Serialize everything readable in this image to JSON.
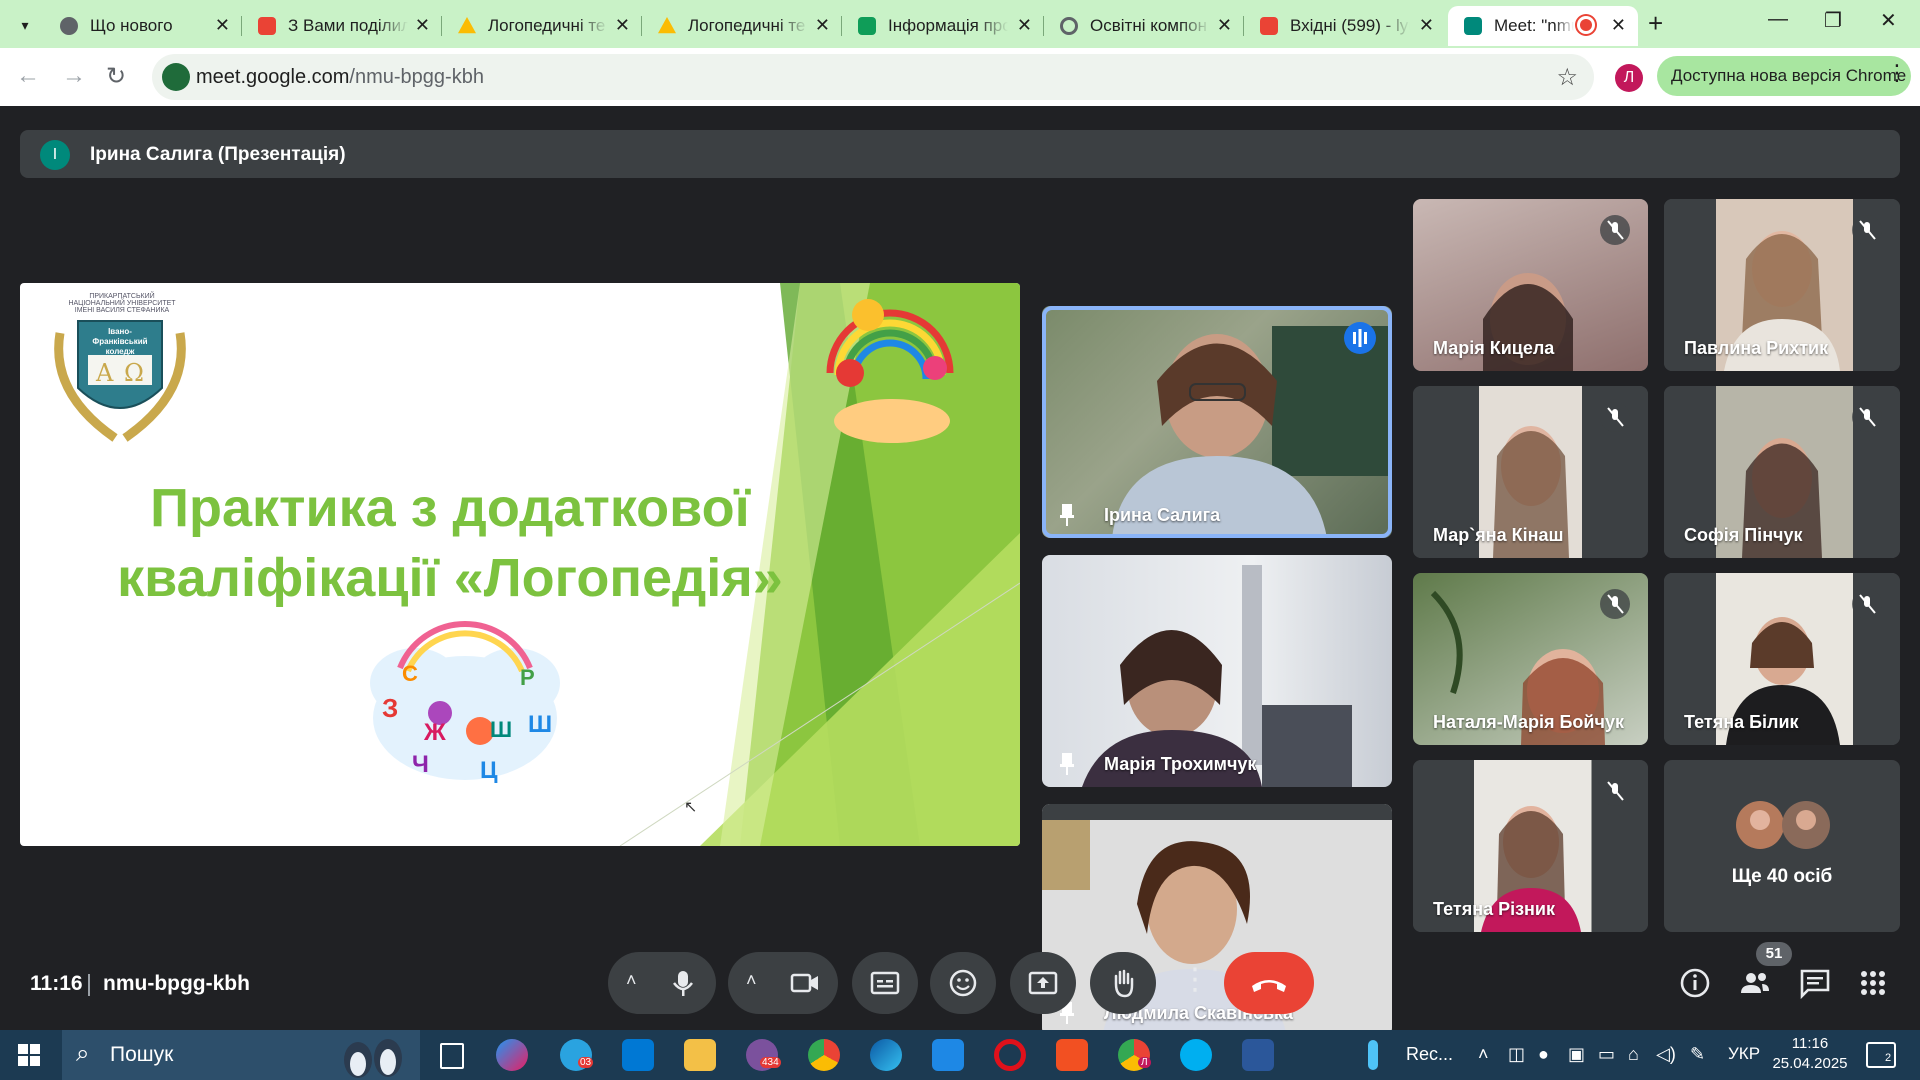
{
  "browser": {
    "tabs": [
      {
        "title": "Що нового",
        "icon": "chrome-icon",
        "color": "#5f6368"
      },
      {
        "title": "З Вами поділил",
        "icon": "gmail-icon",
        "color": "#ea4335"
      },
      {
        "title": "Логопедичні те",
        "icon": "drive-icon",
        "color": "#fbbc04"
      },
      {
        "title": "Логопедичні те",
        "icon": "drive-icon",
        "color": "#fbbc04"
      },
      {
        "title": "Інформація про",
        "icon": "sheets-icon",
        "color": "#0f9d58"
      },
      {
        "title": "Освітні компон",
        "icon": "globe-icon",
        "color": "#5f6368"
      },
      {
        "title": "Вхідні (599) - lyu",
        "icon": "gmail-icon",
        "color": "#ea4335"
      },
      {
        "title": "Meet: \"nmu-",
        "icon": "meet-icon",
        "color": "#00897b",
        "active": true
      }
    ],
    "url_host": "meet.google.com",
    "url_path": "/nmu-bpgg-kbh",
    "profile_initial": "Л",
    "update_label": "Доступна нова версія Chrome"
  },
  "meet": {
    "presenter_initial": "I",
    "presenter_label": "Ірина Салига (Презентація)",
    "slide": {
      "title_line1": "Практика з додаткової",
      "title_line2": "кваліфікації «Логопедія»",
      "college_caption": "ПРИКАРПАТСЬКИЙ НАЦІОНАЛЬНИЙ УНІВЕРСИТЕТ ІМЕНІ ВАСИЛЯ СТЕФАНИКА",
      "college_name": "Івано-Франківський коледж",
      "letters": [
        "З",
        "С",
        "Р",
        "Ш",
        "Ж",
        "Ч",
        "Ц",
        "Ш"
      ]
    },
    "main_tiles": [
      {
        "name": "Ірина Салига",
        "pinned": true,
        "speaking": true
      },
      {
        "name": "Марія Трохимчук",
        "pinned": true
      },
      {
        "name": "Людмила Скавінська",
        "pinned": true
      }
    ],
    "grid_tiles": [
      {
        "name": "Марія Кицела",
        "muted": true
      },
      {
        "name": "Павлина Рихтик",
        "muted": true
      },
      {
        "name": "Мар`яна Кінаш",
        "muted": true
      },
      {
        "name": "Софія Пінчук",
        "muted": true
      },
      {
        "name": "Наталя-Марія Бойчук",
        "muted": true
      },
      {
        "name": "Тетяна Білик",
        "muted": true
      },
      {
        "name": "Тетяна Різник",
        "muted": true
      }
    ],
    "more_label": "Ще 40 осіб",
    "time": "11:16",
    "meeting_code": "nmu-bpgg-kbh",
    "participants_count": "51"
  },
  "taskbar": {
    "search_label": "Пошук",
    "telegram_badge": "03",
    "viber_badge": "434",
    "chrome_badge": "Л",
    "recorder_label": "Rec...",
    "language": "УКР",
    "clock_time": "11:16",
    "clock_date": "25.04.2025",
    "notifications": "2"
  }
}
